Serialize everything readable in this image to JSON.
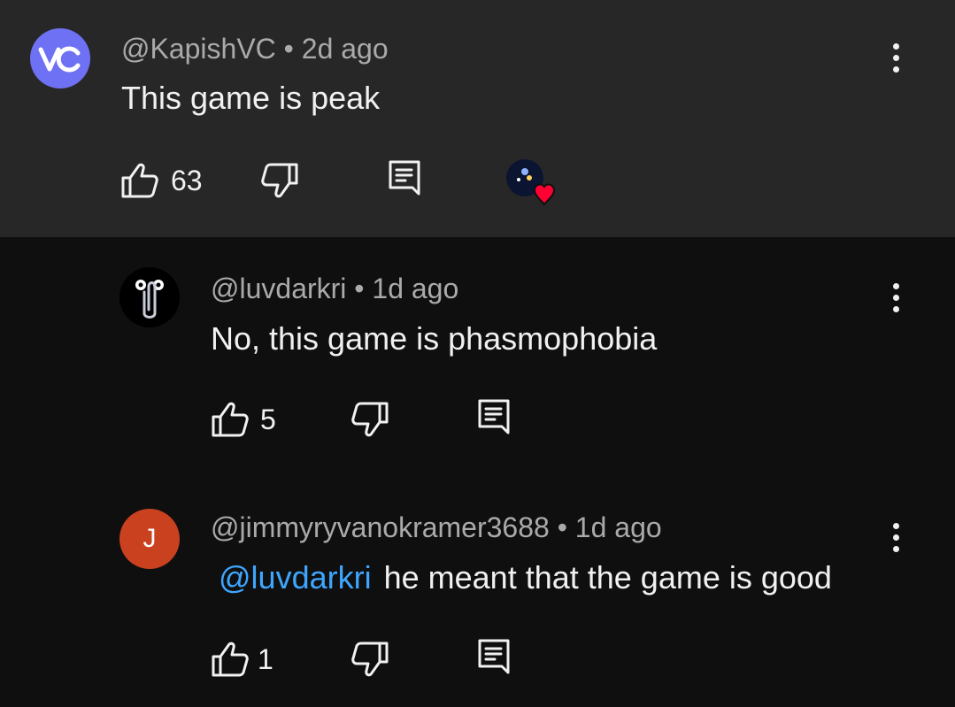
{
  "comments": [
    {
      "avatar_letters": "VC",
      "avatar_color": "#6f71f4",
      "author": "@KapishVC",
      "time": "2d ago",
      "text": "This game is peak",
      "likes": "63",
      "hearted": true
    },
    {
      "avatar_icon": "paperclip-icon",
      "avatar_color": "#000000",
      "author": "@luvdarkri",
      "time": "1d ago",
      "text": "No, this game is phasmophobia",
      "likes": "5"
    },
    {
      "avatar_letters": "J",
      "avatar_color": "#c9411f",
      "author": "@jimmyryvanokramer3688",
      "time": "1d ago",
      "mention": "@luvdarkri",
      "text": "he meant that the game is good",
      "likes": "1"
    }
  ],
  "separator": "•",
  "heart_color": "#ff0033",
  "mention_color": "#3ea6ff"
}
